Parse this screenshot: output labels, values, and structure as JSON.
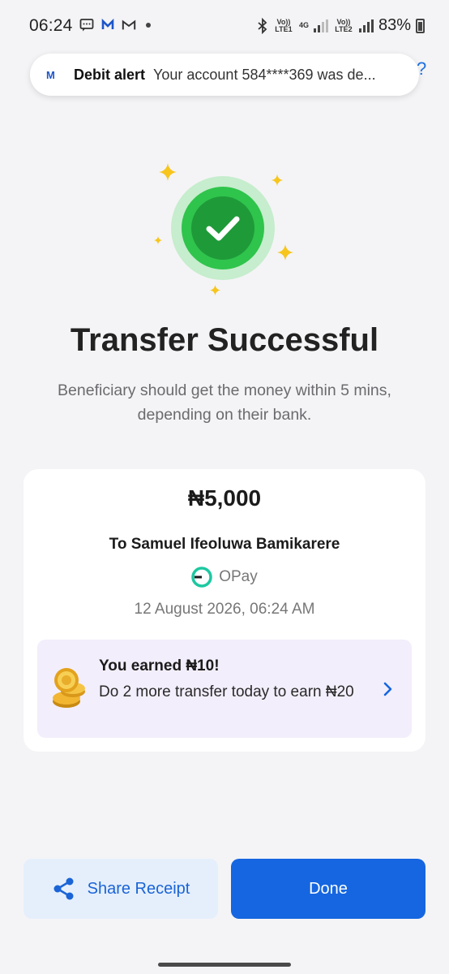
{
  "status_bar": {
    "time": "06:24",
    "network_labels": [
      "Vo)) LTE1",
      "4G",
      "Vo)) LTE2"
    ],
    "battery": "83%",
    "icons": [
      "message-icon",
      "moniepoint-m-icon",
      "gmail-icon",
      "dot-icon",
      "bluetooth-icon",
      "signal-icon",
      "battery-icon"
    ]
  },
  "notification": {
    "logo": "M",
    "title": "Debit alert",
    "body": "Your account 584****369 was de..."
  },
  "header": {
    "help_peek": "?"
  },
  "success": {
    "title": "Transfer Successful",
    "subtitle": "Beneficiary should get the money within 5 mins, depending on their bank."
  },
  "receipt": {
    "amount": "₦5,000",
    "recipient": "To Samuel Ifeoluwa Bamikarere",
    "bank": "OPay",
    "datetime": "12 August 2026, 06:24 AM"
  },
  "reward": {
    "title": "You earned ₦10!",
    "text": "Do 2 more transfer today to earn ₦20"
  },
  "actions": {
    "share_label": "Share Receipt",
    "done_label": "Done"
  },
  "colors": {
    "primary": "#1566e0",
    "success": "#2fc44c",
    "success_dark": "#1f9a39",
    "sparkle": "#f7c51d",
    "reward_bg": "#f3eefb"
  }
}
